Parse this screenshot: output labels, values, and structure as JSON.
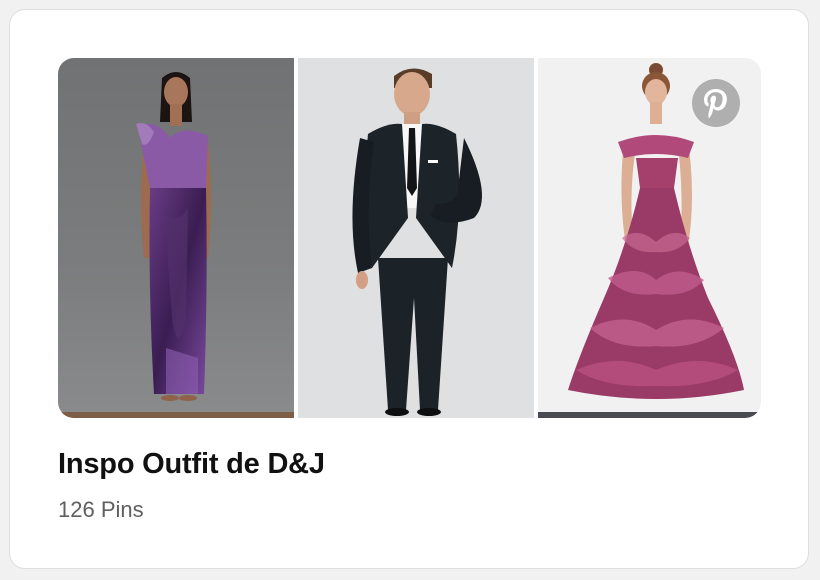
{
  "board": {
    "title": "Inspo Outfit de D&J",
    "pin_count": "126 Pins"
  },
  "images": [
    {
      "description": "model in purple metallic gown"
    },
    {
      "description": "man in black tuxedo"
    },
    {
      "description": "woman in ruffled magenta ball gown"
    }
  ],
  "badge": {
    "icon": "pinterest-logo-icon"
  },
  "colors": {
    "card_bg": "#ffffff",
    "title": "#111111",
    "subtext": "#5f5f5f"
  }
}
